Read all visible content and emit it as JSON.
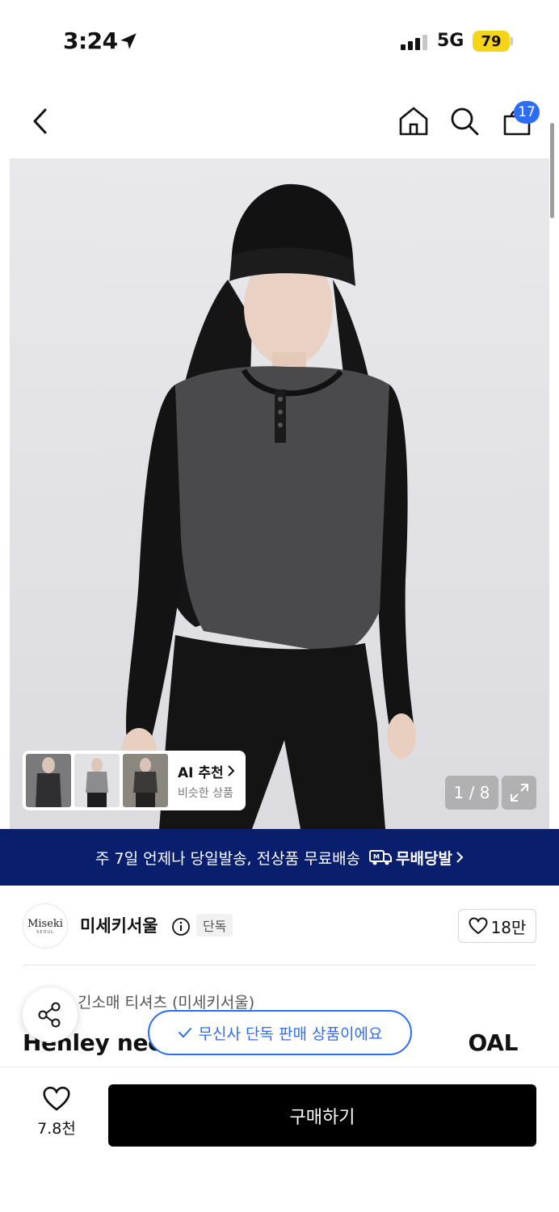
{
  "status": {
    "time": "3:24",
    "network": "5G",
    "battery": "79",
    "battery_color": "#f6d417"
  },
  "nav": {
    "back_icon": "chevron-left-icon",
    "home_icon": "home-icon",
    "search_icon": "search-icon",
    "cart_icon": "cart-icon",
    "cart_count": "17"
  },
  "gallery": {
    "counter": "1 / 8",
    "ai_title": "AI 추천",
    "ai_subtitle": "비슷한 상품"
  },
  "banner": {
    "text": "주 7일 언제나 당일발송, 전상품 무료배송",
    "brand": "무배당발",
    "color": "#0a1e6e"
  },
  "brand": {
    "logo_line1": "Miseki",
    "logo_line2": "SEOUL",
    "name": "미세키서울",
    "badge": "단독",
    "likes": "18만"
  },
  "product": {
    "category": "긴소매 티셔츠 (미세키서울)",
    "title": "Henley nec",
    "title_tail": "OAL"
  },
  "toast": {
    "text": "무신사 단독 판매 상품이에요",
    "accent": "#2d6cf6"
  },
  "bottom": {
    "wish_count": "7.8천",
    "buy_label": "구매하기"
  }
}
